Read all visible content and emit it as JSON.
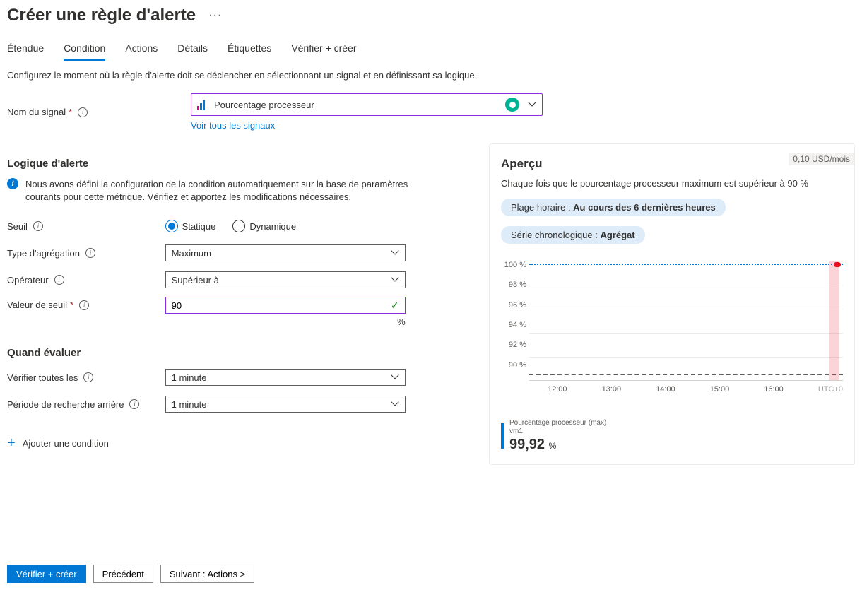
{
  "title": "Créer une règle d'alerte",
  "tabs": [
    "Étendue",
    "Condition",
    "Actions",
    "Détails",
    "Étiquettes",
    "Vérifier + créer"
  ],
  "active_tab": 1,
  "description": "Configurez le moment où la règle d'alerte doit se déclencher en sélectionnant un signal et en définissant sa logique.",
  "signal_name_label": "Nom du signal",
  "signal_value": "Pourcentage processeur",
  "see_all_signals": "Voir tous les signaux",
  "alert_logic_heading": "Logique d'alerte",
  "info_text": "Nous avons défini la configuration de la condition automatiquement sur la base de paramètres courants pour cette métrique. Vérifiez et apportez les modifications nécessaires.",
  "threshold_label": "Seuil",
  "threshold_static": "Statique",
  "threshold_dynamic": "Dynamique",
  "aggregation_label": "Type d'agrégation",
  "aggregation_value": "Maximum",
  "operator_label": "Opérateur",
  "operator_value": "Supérieur à",
  "threshold_value_label": "Valeur de seuil",
  "threshold_value": "90",
  "threshold_unit": "%",
  "when_heading": "Quand évaluer",
  "check_every_label": "Vérifier toutes les",
  "check_every_value": "1 minute",
  "lookback_label": "Période de recherche arrière",
  "lookback_value": "1 minute",
  "add_condition": "Ajouter une condition",
  "preview": {
    "title": "Aperçu",
    "cost": "0,10 USD/mois",
    "desc": "Chaque fois que le pourcentage processeur maximum est supérieur à 90 %",
    "pill_time_prefix": "Plage horaire : ",
    "pill_time_value": "Au cours des 6 dernières heures",
    "pill_series_prefix": "Série chronologique : ",
    "pill_series_value": "Agrégat",
    "legend_name": "Pourcentage processeur (max)",
    "legend_sub": "vm1",
    "legend_value": "99,92",
    "legend_unit": "%"
  },
  "chart_data": {
    "type": "line",
    "ylabel": "",
    "ylim": [
      90,
      100
    ],
    "y_ticks": [
      "100 %",
      "98 %",
      "96 %",
      "94 %",
      "92 %",
      "90 %"
    ],
    "x_ticks": [
      "12:00",
      "13:00",
      "14:00",
      "15:00",
      "16:00",
      "UTC+0"
    ],
    "threshold": 90,
    "series": [
      {
        "name": "Pourcentage processeur (max) — vm1",
        "approximate_value": 99.92
      }
    ]
  },
  "footer": {
    "review_create": "Vérifier + créer",
    "previous": "Précédent",
    "next": "Suivant : Actions >"
  }
}
